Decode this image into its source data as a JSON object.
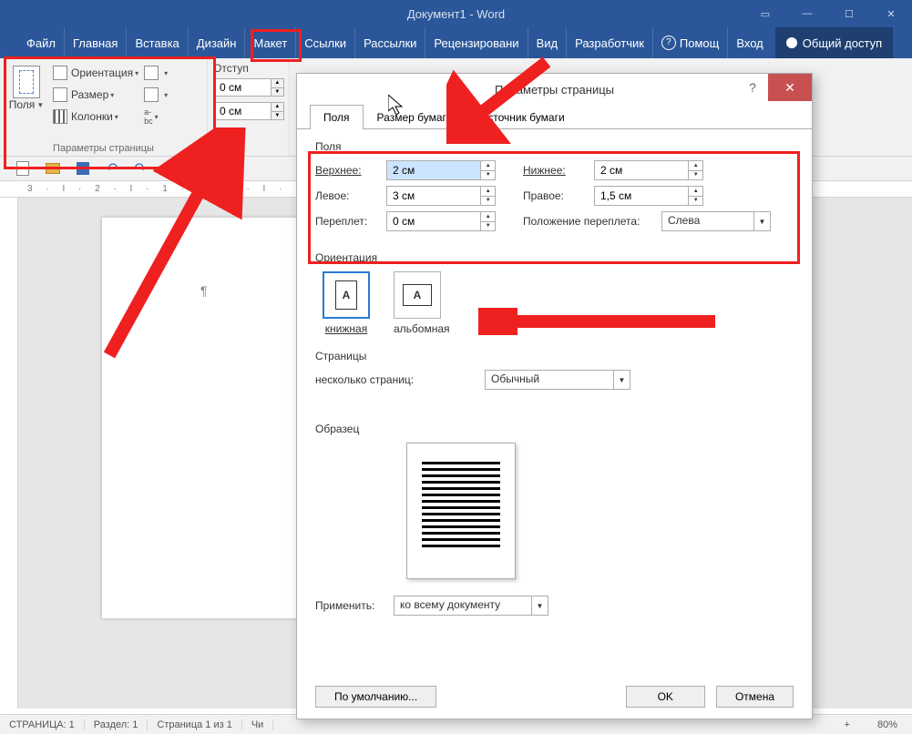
{
  "titlebar": {
    "title": "Документ1 - Word"
  },
  "menu": {
    "file": "Файл",
    "home": "Главная",
    "insert": "Вставка",
    "design": "Дизайн",
    "layout": "Макет",
    "refs": "Ссылки",
    "mail": "Рассылки",
    "review": "Рецензировани",
    "view": "Вид",
    "dev": "Разработчик",
    "help": "Помощ",
    "login": "Вход",
    "share": "Общий доступ"
  },
  "ribbon": {
    "margins": "Поля",
    "orientation": "Ориентация",
    "size": "Размер",
    "columns": "Колонки",
    "indent": "Отступ",
    "group_page": "Параметры страницы",
    "indent_val": "0 см"
  },
  "ruler_h": "3 · I · 2 · I · 1 · I · · · I · · · I · 1 · I · 2",
  "status": {
    "page": "СТРАНИЦА: 1",
    "section": "Раздел: 1",
    "pageof": "Страница 1 из 1",
    "words": "Чи",
    "zoom": "80%"
  },
  "dialog": {
    "title": "Параметры страницы",
    "tabs": {
      "margins": "Поля",
      "paper": "Размер бумаги",
      "source": "Источник бумаги"
    },
    "fs_margins": "Поля",
    "top": "Верхнее:",
    "bottom": "Нижнее:",
    "left": "Левое:",
    "right": "Правое:",
    "gutter": "Переплет:",
    "gutter_pos": "Положение переплета:",
    "val_top": "2 см",
    "val_bottom": "2 см",
    "val_left": "3 см",
    "val_right": "1,5 см",
    "val_gutter": "0 см",
    "val_gutter_pos": "Слева",
    "fs_orient": "Ориентация",
    "portrait": "книжная",
    "landscape": "альбомная",
    "fs_pages": "Страницы",
    "multi": "несколько страниц:",
    "multi_val": "Обычный",
    "fs_preview": "Образец",
    "apply": "Применить:",
    "apply_val": "ко всему документу",
    "default": "По умолчанию...",
    "ok": "OK",
    "cancel": "Отмена"
  }
}
